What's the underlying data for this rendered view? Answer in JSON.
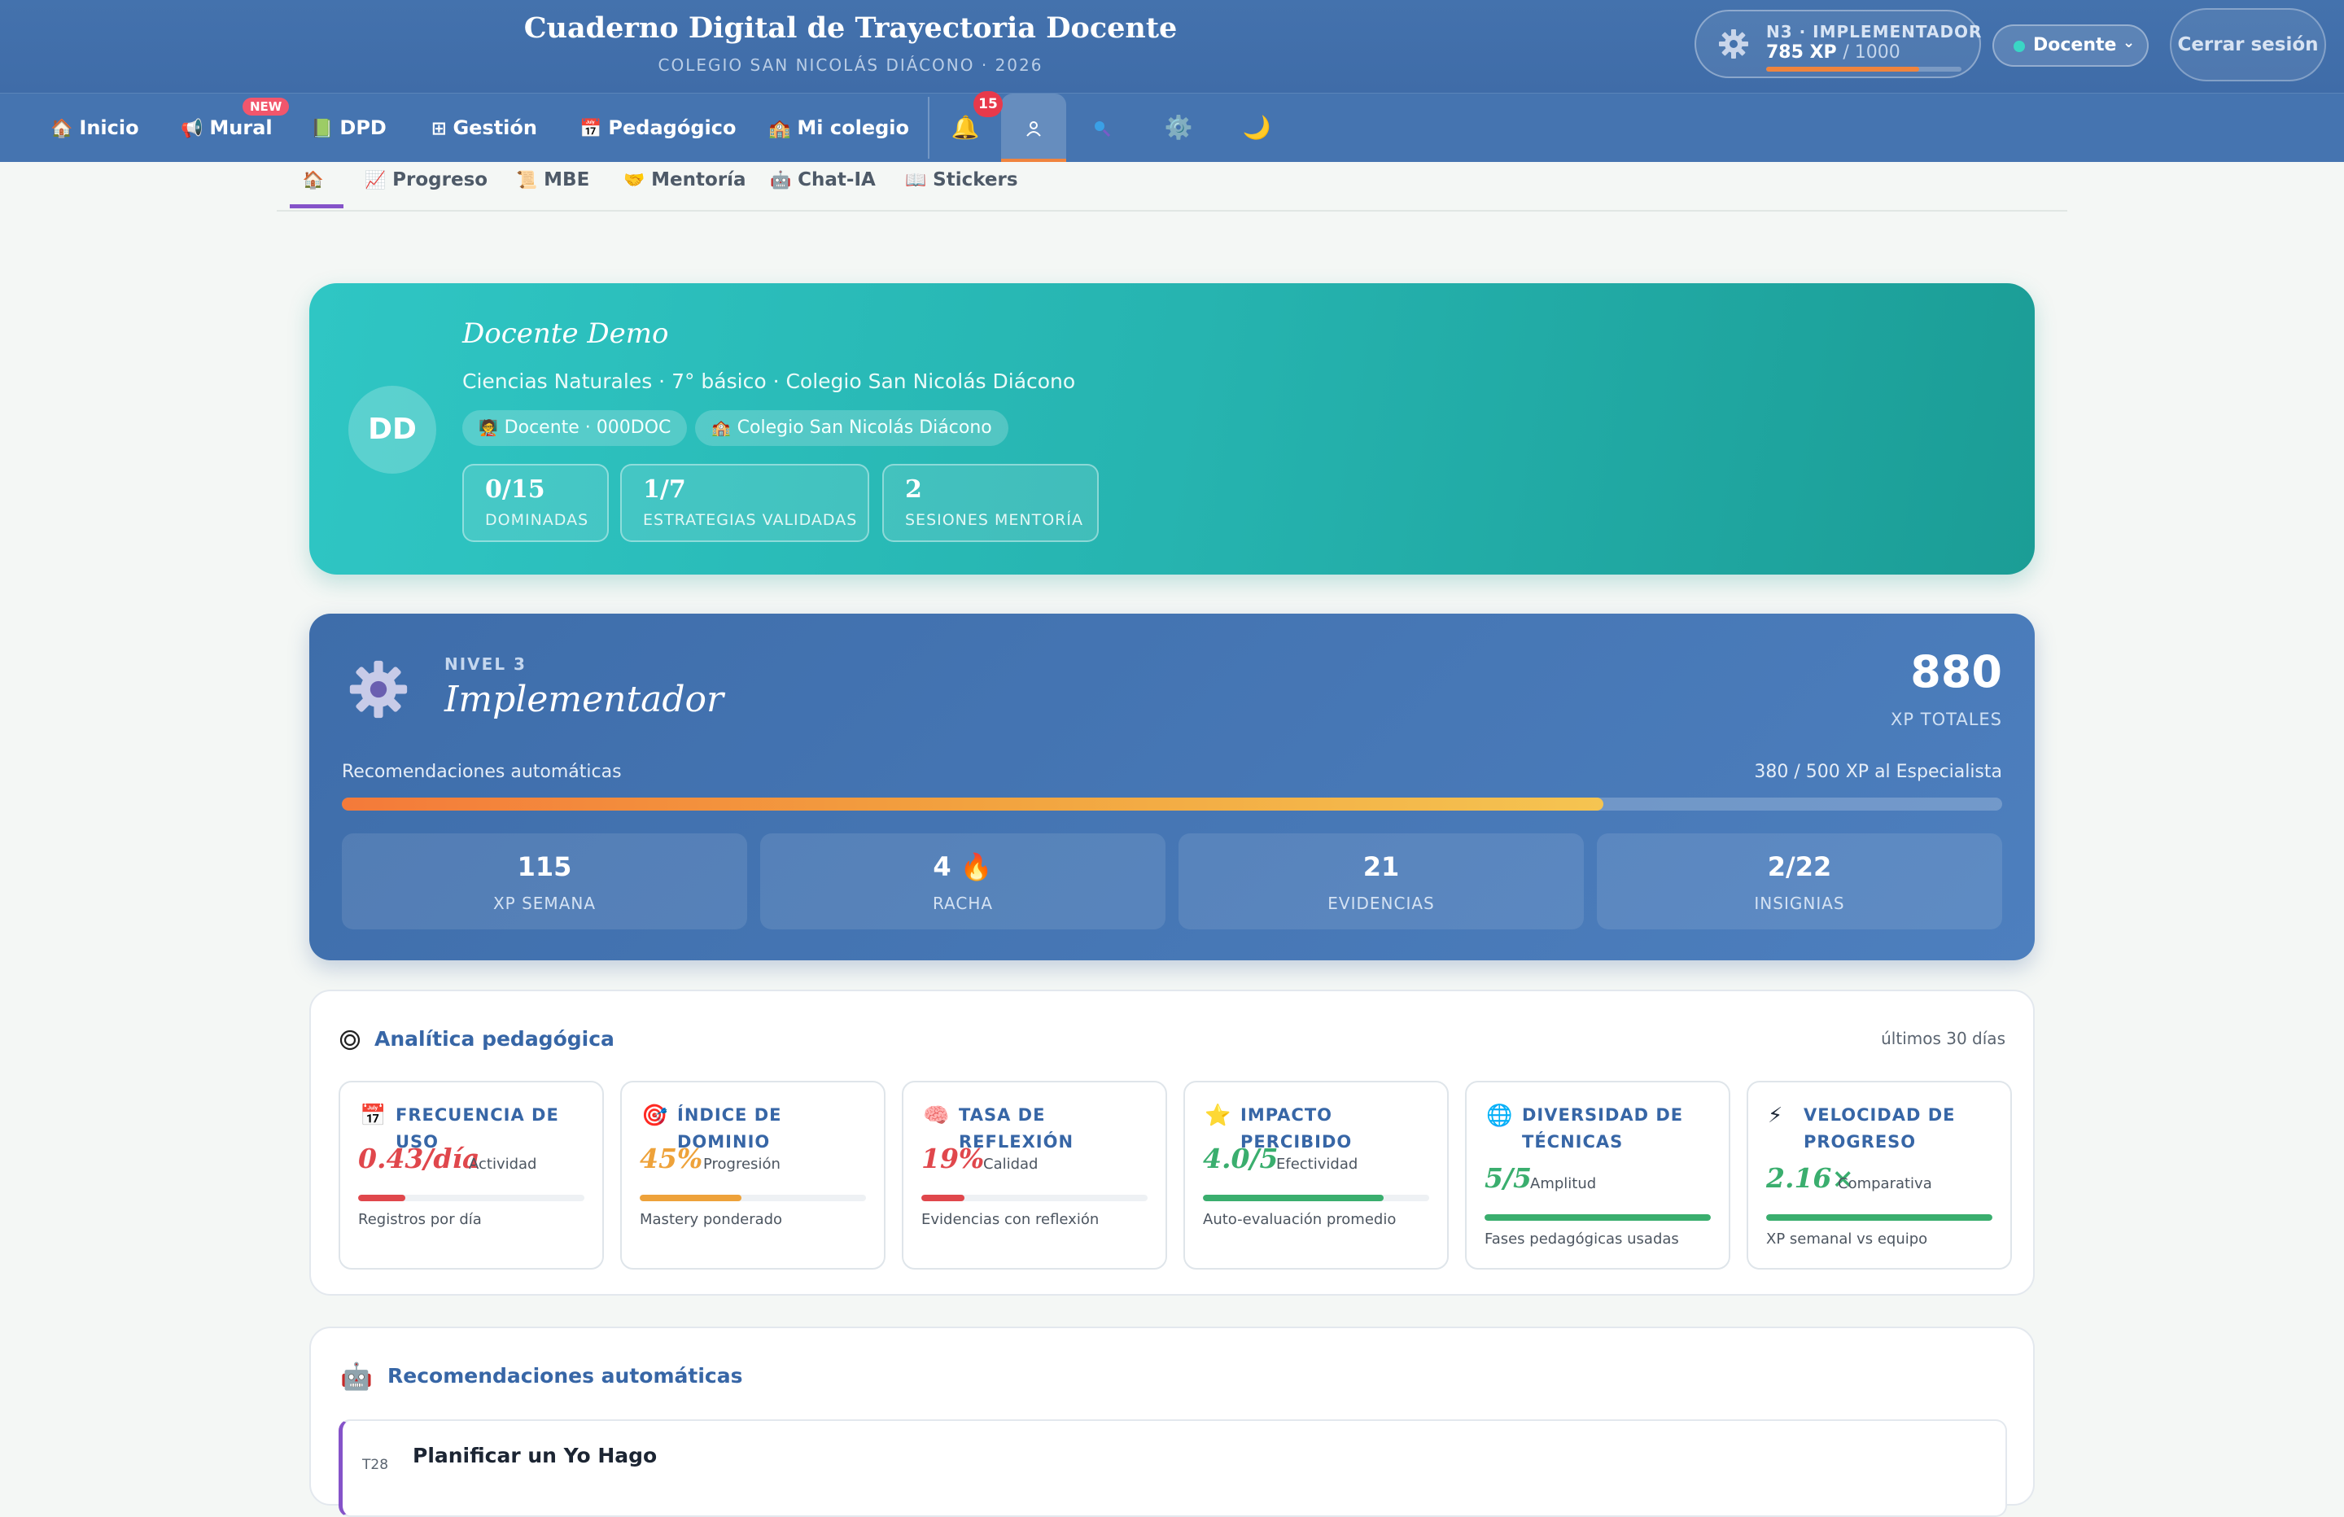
{
  "header": {
    "title": "Cuaderno Digital de Trayectoria Docente",
    "subtitle": "COLEGIO SAN NICOLÁS DIÁCONO · 2026",
    "level_label": "N3 · IMPLEMENTADOR",
    "xp_current": "785 XP",
    "xp_max": "/ 1000",
    "xp_progress": 0.785,
    "role": "Docente",
    "logout": "Cerrar sesión"
  },
  "nav": {
    "items": [
      {
        "icon": "🏠",
        "label": "Inicio"
      },
      {
        "icon": "📢",
        "label": "Mural"
      },
      {
        "icon": "📗",
        "label": "DPD"
      },
      {
        "icon": "⊞",
        "label": "Gestión"
      },
      {
        "icon": "📅",
        "label": "Pedagógico"
      },
      {
        "icon": "🏫",
        "label": "Mi colegio"
      }
    ],
    "new_badge": "NEW",
    "notifications_count": "15"
  },
  "subtabs": [
    {
      "icon": "🏠",
      "label": ""
    },
    {
      "icon": "📈",
      "label": "Progreso"
    },
    {
      "icon": "📜",
      "label": "MBE"
    },
    {
      "icon": "🤝",
      "label": "Mentoría"
    },
    {
      "icon": "🤖",
      "label": "Chat-IA"
    },
    {
      "icon": "📖",
      "label": "Stickers"
    }
  ],
  "profile": {
    "initials": "DD",
    "name": "Docente Demo",
    "subtitle": "Ciencias Naturales · 7° básico · Colegio San Nicolás Diácono",
    "chips": [
      {
        "icon": "🧑‍🏫",
        "label": "Docente · 000DOC"
      },
      {
        "icon": "🏫",
        "label": "Colegio San Nicolás Diácono"
      }
    ],
    "stats": [
      {
        "value": "0/15",
        "label": "DOMINADAS"
      },
      {
        "value": "1/7",
        "label": "ESTRATEGIAS VALIDADAS"
      },
      {
        "value": "2",
        "label": "SESIONES MENTORÍA"
      }
    ]
  },
  "level": {
    "nivel": "NIVEL 3",
    "name": "Implementador",
    "total_xp": "880",
    "total_label": "XP TOTALES",
    "recommendations_label": "Recomendaciones automáticas",
    "to_next": "380 / 500 XP al Especialista",
    "progress": 0.76,
    "stats": [
      {
        "value": "115",
        "label": "XP SEMANA"
      },
      {
        "value": "4 🔥",
        "label": "RACHA"
      },
      {
        "value": "21",
        "label": "EVIDENCIAS"
      },
      {
        "value": "2/22",
        "label": "INSIGNIAS"
      }
    ]
  },
  "analytics": {
    "title": "Analítica pedagógica",
    "period": "últimos 30 días",
    "metrics": [
      {
        "icon": "📅",
        "title": "FRECUENCIA DE USO",
        "value": "0.43/día",
        "tag": "Actividad",
        "desc": "Registros por día",
        "progress": 0.21,
        "color": "#e0474c"
      },
      {
        "icon": "🎯",
        "title": "ÍNDICE DE DOMINIO",
        "value": "45%",
        "tag": "Progresión",
        "desc": "Mastery ponderado",
        "progress": 0.45,
        "color": "#eea23a"
      },
      {
        "icon": "🧠",
        "title": "TASA DE REFLEXIÓN",
        "value": "19%",
        "tag": "Calidad",
        "desc": "Evidencias con reflexión",
        "progress": 0.19,
        "color": "#e0474c"
      },
      {
        "icon": "⭐",
        "title": "IMPACTO PERCIBIDO",
        "value": "4.0/5",
        "tag": "Efectividad",
        "desc": "Auto-evaluación promedio",
        "progress": 0.8,
        "color": "#3aae6e"
      },
      {
        "icon": "🌐",
        "title": "DIVERSIDAD DE TÉCNICAS",
        "value": "5/5",
        "tag": "Amplitud",
        "desc": "Fases pedagógicas usadas",
        "progress": 1.0,
        "color": "#3aae6e"
      },
      {
        "icon": "⚡",
        "title": "VELOCIDAD DE PROGRESO",
        "value": "2.16×",
        "tag": "Comparativa",
        "desc": "XP semanal vs equipo",
        "progress": 1.0,
        "color": "#3aae6e"
      }
    ]
  },
  "recommendations": {
    "title": "Recomendaciones automáticas",
    "items": [
      {
        "code": "T28",
        "title": "Planificar un Yo Hago"
      }
    ]
  }
}
